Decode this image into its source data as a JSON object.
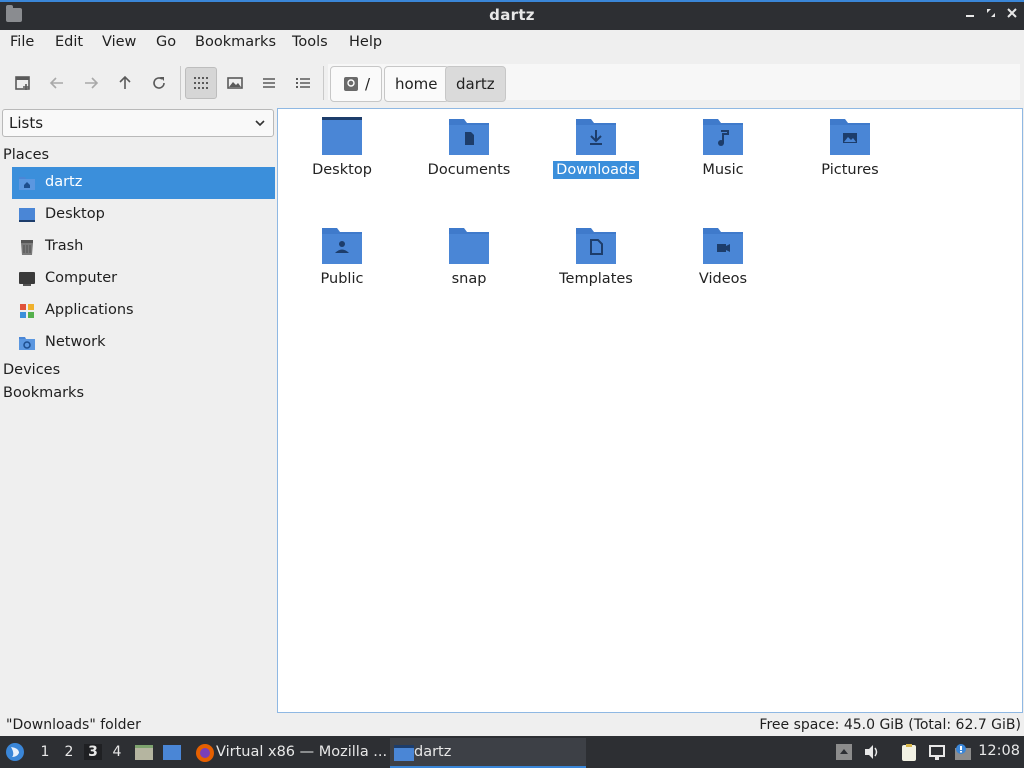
{
  "window": {
    "title": "dartz"
  },
  "menu": [
    "File",
    "Edit",
    "View",
    "Go",
    "Bookmarks",
    "Tools",
    "Help"
  ],
  "breadcrumb": {
    "root": "/",
    "items": [
      "home",
      "dartz"
    ]
  },
  "sidebar": {
    "mode": "Lists",
    "places_label": "Places",
    "places": [
      {
        "label": "dartz",
        "icon": "home-folder-icon",
        "selected": true
      },
      {
        "label": "Desktop",
        "icon": "desktop-icon"
      },
      {
        "label": "Trash",
        "icon": "trash-icon"
      },
      {
        "label": "Computer",
        "icon": "computer-icon"
      },
      {
        "label": "Applications",
        "icon": "applications-icon"
      },
      {
        "label": "Network",
        "icon": "network-icon"
      }
    ],
    "devices_label": "Devices",
    "bookmarks_label": "Bookmarks"
  },
  "files": [
    {
      "name": "Desktop",
      "icon": "desktop-folder-icon"
    },
    {
      "name": "Documents",
      "icon": "documents-folder-icon"
    },
    {
      "name": "Downloads",
      "icon": "downloads-folder-icon",
      "selected": true
    },
    {
      "name": "Music",
      "icon": "music-folder-icon"
    },
    {
      "name": "Pictures",
      "icon": "pictures-folder-icon"
    },
    {
      "name": "Public",
      "icon": "public-folder-icon"
    },
    {
      "name": "snap",
      "icon": "folder-icon"
    },
    {
      "name": "Templates",
      "icon": "templates-folder-icon"
    },
    {
      "name": "Videos",
      "icon": "videos-folder-icon"
    }
  ],
  "status": {
    "selection": "\"Downloads\" folder",
    "free_space": "Free space: 45.0 GiB (Total: 62.7 GiB)"
  },
  "taskbar": {
    "workspaces": [
      "1",
      "2",
      "3",
      "4"
    ],
    "active_workspace": "3",
    "tasks": [
      {
        "label": "Virtual x86 — Mozilla ...",
        "icon": "firefox-icon"
      },
      {
        "label": "dartz",
        "icon": "file-manager-icon",
        "active": true
      }
    ],
    "clock": "12:08"
  },
  "colors": {
    "accent": "#3b8fdb",
    "folder": "#4a86d6",
    "titlebar": "#2d2f33"
  }
}
